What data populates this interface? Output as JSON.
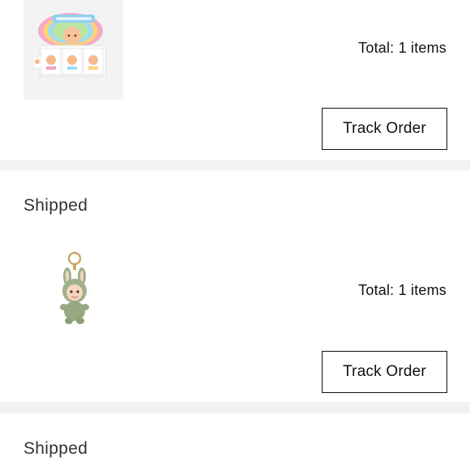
{
  "orders": [
    {
      "status": "",
      "product_image": "blind-box-set-image",
      "total": "Total: 1 items",
      "action_label": "Track Order"
    },
    {
      "status": "Shipped",
      "product_image": "green-bunny-plush-keychain-image",
      "total": "Total: 1 items",
      "action_label": "Track Order"
    },
    {
      "status": "Shipped"
    }
  ],
  "colors": {
    "page_background": "#f2f2f2",
    "card_background": "#ffffff",
    "button_border": "#111111"
  }
}
